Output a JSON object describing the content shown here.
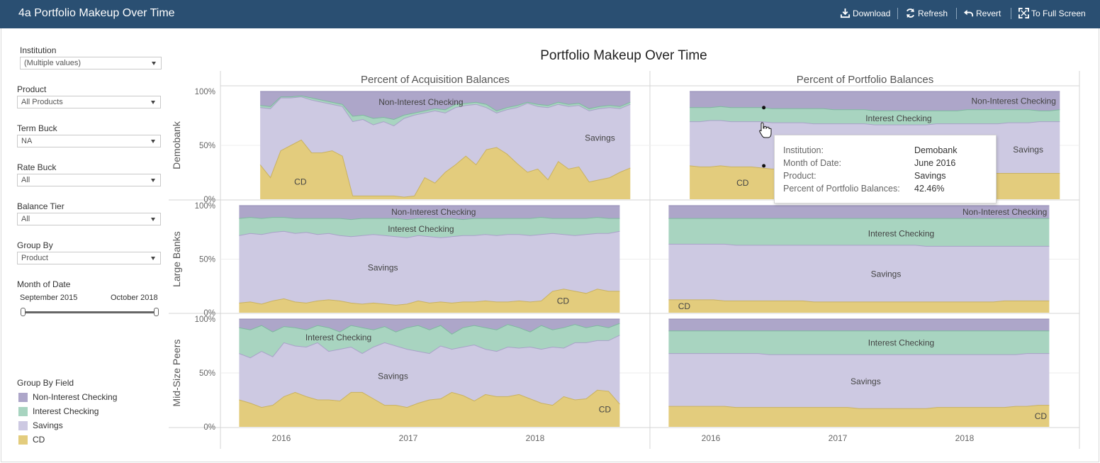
{
  "window": {
    "title": "4a Portfolio Makeup Over Time",
    "toolbar": {
      "download": "Download",
      "refresh": "Refresh",
      "revert": "Revert",
      "fullscreen": "To Full Screen"
    }
  },
  "filters": {
    "institution": {
      "label": "Institution",
      "value": "(Multiple values)"
    },
    "product": {
      "label": "Product",
      "value": "All Products"
    },
    "term_buck": {
      "label": "Term Buck",
      "value": "NA"
    },
    "rate_buck": {
      "label": "Rate Buck",
      "value": "All"
    },
    "balance_tier": {
      "label": "Balance Tier",
      "value": "All"
    },
    "group_by": {
      "label": "Group By",
      "value": "Product"
    },
    "month_of_date": {
      "label": "Month of Date",
      "start": "September 2015",
      "end": "October 2018",
      "start_fraction": 0.0,
      "end_fraction": 1.0
    }
  },
  "legend": {
    "title": "Group By Field",
    "items": [
      {
        "label": "Non-Interest Checking",
        "color": "#ada6c9"
      },
      {
        "label": "Interest Checking",
        "color": "#a8d4c0"
      },
      {
        "label": "Savings",
        "color": "#cdc9e2"
      },
      {
        "label": "CD",
        "color": "#e3cc7d"
      }
    ]
  },
  "tooltip": {
    "rows": [
      {
        "key": "Institution:",
        "value": "Demobank"
      },
      {
        "key": "Month of Date:",
        "value": "June 2016"
      },
      {
        "key": "Product:",
        "value": "Savings"
      },
      {
        "key": "Percent of Portfolio Balances:",
        "value": "42.46%"
      }
    ]
  },
  "chart_data": {
    "type": "area",
    "title": "Portfolio Makeup Over Time",
    "columns": [
      "Percent of Acquisition Balances",
      "Percent of Portfolio Balances"
    ],
    "rows": [
      "Demobank",
      "Large Banks",
      "Mid-Size Peers"
    ],
    "y_ticks": [
      "100%",
      "50%",
      "0%"
    ],
    "x_ticks": [
      "2016",
      "2017",
      "2018"
    ],
    "ylim": [
      0,
      100
    ],
    "stack_order": [
      "CD",
      "Savings",
      "Interest Checking",
      "Non-Interest Checking"
    ],
    "colors": {
      "CD": "#e3cc7d",
      "Savings": "#cdc9e2",
      "Interest Checking": "#a8d4c0",
      "Non-Interest Checking": "#ada6c9"
    },
    "panels": [
      {
        "row": "Demobank",
        "column": "Percent of Acquisition Balances",
        "start": 2015.833,
        "end": 2018.75,
        "cd": [
          32,
          20,
          45,
          50,
          55,
          43,
          43,
          45,
          40,
          3,
          3,
          3,
          3,
          3,
          2,
          3,
          20,
          15,
          25,
          32,
          40,
          32,
          46,
          48,
          42,
          33,
          25,
          28,
          18,
          35,
          28,
          30,
          16,
          18,
          20,
          25,
          29
        ],
        "savings_top": [
          85,
          84,
          94,
          94,
          95,
          92,
          90,
          88,
          86,
          72,
          74,
          69,
          72,
          68,
          75,
          78,
          80,
          82,
          80,
          85,
          87,
          88,
          85,
          80,
          83,
          85,
          89,
          86,
          85,
          88,
          86,
          87,
          82,
          84,
          85,
          84,
          88
        ],
        "ic_top": [
          87,
          86,
          95,
          95,
          96,
          94,
          92,
          90,
          88,
          77,
          78,
          75,
          76,
          74,
          78,
          80,
          82,
          84,
          83,
          88,
          89,
          90,
          88,
          82,
          85,
          87,
          90,
          88,
          87,
          90,
          88,
          89,
          84,
          86,
          87,
          86,
          90
        ],
        "labels": [
          {
            "text": "Non-Interest Checking",
            "x": 2017.1,
            "y": 90,
            "anchor": "middle"
          },
          {
            "text": "Savings",
            "x": 2018.63,
            "y": 57,
            "anchor": "end"
          },
          {
            "text": "CD",
            "x": 2016.15,
            "y": 16,
            "anchor": "middle"
          }
        ]
      },
      {
        "row": "Large Banks",
        "column": "Percent of Acquisition Balances",
        "start": 2015.667,
        "end": 2018.667,
        "cd": [
          9,
          10,
          8,
          11,
          13,
          10,
          9,
          11,
          12,
          11,
          9,
          8,
          9,
          8,
          7,
          8,
          11,
          9,
          10,
          9,
          10,
          10,
          11,
          10,
          10,
          11,
          10,
          11,
          20,
          22,
          20,
          18,
          22,
          20,
          20
        ],
        "savings_top": [
          72,
          74,
          73,
          75,
          76,
          74,
          75,
          73,
          74,
          72,
          71,
          72,
          73,
          72,
          71,
          70,
          72,
          71,
          70,
          71,
          72,
          72,
          73,
          72,
          73,
          73,
          72,
          73,
          74,
          73,
          72,
          73,
          74,
          74,
          76
        ],
        "ic_top": [
          88,
          89,
          88,
          89,
          89,
          88,
          88,
          88,
          88,
          88,
          87,
          88,
          88,
          88,
          88,
          87,
          88,
          88,
          88,
          88,
          87,
          88,
          88,
          88,
          88,
          88,
          88,
          89,
          88,
          88,
          88,
          88,
          89,
          88,
          88
        ],
        "labels": [
          {
            "text": "Non-Interest Checking",
            "x": 2017.2,
            "y": 94,
            "anchor": "middle"
          },
          {
            "text": "Interest Checking",
            "x": 2017.1,
            "y": 78,
            "anchor": "middle"
          },
          {
            "text": "Savings",
            "x": 2016.8,
            "y": 42,
            "anchor": "middle"
          },
          {
            "text": "CD",
            "x": 2018.22,
            "y": 11,
            "anchor": "middle"
          }
        ]
      },
      {
        "row": "Mid-Size Peers",
        "column": "Percent of Acquisition Balances",
        "start": 2015.667,
        "end": 2018.667,
        "cd": [
          25,
          22,
          18,
          20,
          28,
          32,
          28,
          25,
          25,
          24,
          32,
          32,
          26,
          20,
          20,
          18,
          22,
          25,
          26,
          32,
          29,
          24,
          30,
          28,
          28,
          30,
          26,
          22,
          20,
          28,
          25,
          26,
          34,
          33,
          21
        ],
        "savings_top": [
          68,
          64,
          70,
          65,
          78,
          75,
          74,
          78,
          70,
          72,
          74,
          68,
          74,
          78,
          75,
          72,
          70,
          68,
          75,
          72,
          74,
          76,
          72,
          70,
          74,
          73,
          74,
          72,
          74,
          73,
          78,
          78,
          80,
          80,
          85
        ],
        "ic_top": [
          92,
          90,
          94,
          88,
          93,
          92,
          90,
          94,
          92,
          88,
          94,
          92,
          90,
          93,
          88,
          92,
          94,
          90,
          94,
          86,
          92,
          94,
          92,
          90,
          95,
          92,
          88,
          94,
          90,
          92,
          95,
          92,
          94,
          92,
          96
        ],
        "labels": [
          {
            "text": "Interest Checking",
            "x": 2016.45,
            "y": 83,
            "anchor": "middle"
          },
          {
            "text": "Savings",
            "x": 2016.88,
            "y": 47,
            "anchor": "middle"
          },
          {
            "text": "CD",
            "x": 2018.55,
            "y": 16,
            "anchor": "middle"
          }
        ]
      },
      {
        "row": "Demobank",
        "column": "Percent of Portfolio Balances",
        "start": 2015.833,
        "end": 2018.75,
        "cd": [
          31,
          30,
          30,
          31,
          30,
          30,
          30,
          29,
          28,
          28,
          28,
          27,
          27,
          27,
          26,
          26,
          26,
          26,
          25,
          25,
          25,
          25,
          25,
          25,
          24,
          24,
          24,
          24,
          24,
          24,
          24,
          24,
          24,
          24,
          24,
          24,
          24
        ],
        "savings_top": [
          72,
          72,
          73,
          73,
          72,
          72,
          72,
          72,
          71,
          71,
          71,
          71,
          70,
          70,
          70,
          70,
          70,
          70,
          69,
          69,
          69,
          69,
          69,
          69,
          70,
          70,
          70,
          70,
          70,
          70,
          70,
          71,
          71,
          71,
          72,
          72,
          72
        ],
        "ic_top": [
          85,
          85,
          85,
          86,
          85,
          85,
          85,
          85,
          84,
          84,
          84,
          84,
          84,
          84,
          83,
          83,
          83,
          83,
          82,
          82,
          82,
          82,
          82,
          82,
          82,
          82,
          82,
          83,
          83,
          83,
          83,
          83,
          83,
          83,
          82,
          82,
          83
        ],
        "labels": [
          {
            "text": "Non-Interest Checking",
            "x": 2018.72,
            "y": 91,
            "anchor": "end"
          },
          {
            "text": "Interest Checking",
            "x": 2017.48,
            "y": 75,
            "anchor": "middle"
          },
          {
            "text": "Savings",
            "x": 2018.62,
            "y": 46,
            "anchor": "end"
          },
          {
            "text": "CD",
            "x": 2016.25,
            "y": 15,
            "anchor": "middle"
          }
        ]
      },
      {
        "row": "Large Banks",
        "column": "Percent of Portfolio Balances",
        "start": 2015.667,
        "end": 2018.667,
        "cd": [
          12,
          12,
          12,
          12,
          12,
          11,
          11,
          11,
          11,
          11,
          11,
          11,
          11,
          10,
          10,
          10,
          10,
          10,
          10,
          10,
          10,
          10,
          10,
          10,
          10,
          10,
          10,
          10,
          10,
          10,
          11,
          11,
          11,
          11,
          11
        ],
        "savings_top": [
          64,
          64,
          64,
          64,
          64,
          64,
          63,
          63,
          63,
          63,
          63,
          63,
          63,
          63,
          63,
          63,
          63,
          63,
          63,
          63,
          63,
          63,
          63,
          62,
          62,
          62,
          62,
          62,
          62,
          62,
          62,
          62,
          62,
          62,
          62
        ],
        "ic_top": [
          88,
          88,
          88,
          88,
          88,
          88,
          88,
          88,
          88,
          88,
          88,
          88,
          88,
          88,
          88,
          88,
          88,
          88,
          88,
          88,
          88,
          88,
          88,
          88,
          88,
          88,
          88,
          88,
          88,
          88,
          88,
          88,
          88,
          88,
          88
        ],
        "labels": [
          {
            "text": "Non-Interest Checking",
            "x": 2018.65,
            "y": 94,
            "anchor": "end"
          },
          {
            "text": "Interest Checking",
            "x": 2017.5,
            "y": 74,
            "anchor": "middle"
          },
          {
            "text": "Savings",
            "x": 2017.38,
            "y": 36,
            "anchor": "middle"
          },
          {
            "text": "CD",
            "x": 2015.79,
            "y": 6,
            "anchor": "middle"
          }
        ]
      },
      {
        "row": "Mid-Size Peers",
        "column": "Percent of Portfolio Balances",
        "start": 2015.667,
        "end": 2018.667,
        "cd": [
          19,
          19,
          19,
          19,
          19,
          19,
          18,
          18,
          18,
          18,
          18,
          18,
          18,
          18,
          18,
          18,
          18,
          17,
          17,
          17,
          17,
          17,
          17,
          17,
          18,
          18,
          18,
          18,
          18,
          18,
          18,
          19,
          19,
          20,
          20
        ],
        "savings_top": [
          68,
          68,
          68,
          68,
          68,
          68,
          68,
          68,
          68,
          67,
          67,
          67,
          67,
          67,
          67,
          67,
          67,
          67,
          67,
          67,
          67,
          67,
          67,
          67,
          67,
          67,
          67,
          67,
          67,
          67,
          67,
          67,
          68,
          68,
          68
        ],
        "ic_top": [
          89,
          89,
          89,
          89,
          89,
          89,
          89,
          89,
          89,
          89,
          89,
          89,
          89,
          89,
          89,
          89,
          89,
          89,
          89,
          89,
          89,
          89,
          89,
          89,
          89,
          89,
          89,
          89,
          89,
          89,
          89,
          89,
          89,
          89,
          89
        ],
        "labels": [
          {
            "text": "Interest Checking",
            "x": 2017.5,
            "y": 78,
            "anchor": "middle"
          },
          {
            "text": "Savings",
            "x": 2017.22,
            "y": 42,
            "anchor": "middle"
          },
          {
            "text": "CD",
            "x": 2018.6,
            "y": 10,
            "anchor": "middle"
          }
        ]
      }
    ],
    "tooltip_marks": [
      {
        "row": "Demobank",
        "column": "Percent of Portfolio Balances",
        "x": 2016.417,
        "y": 85
      },
      {
        "row": "Demobank",
        "column": "Percent of Portfolio Balances",
        "x": 2016.417,
        "y": 31
      }
    ]
  }
}
